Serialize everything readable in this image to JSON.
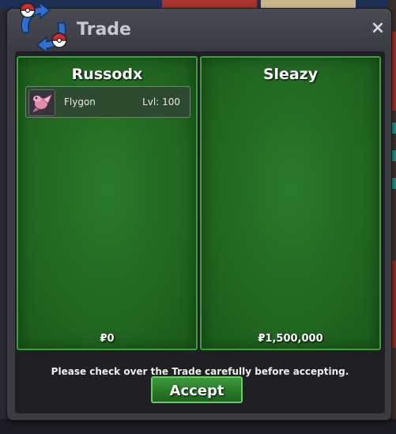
{
  "window": {
    "title": "Trade",
    "close_label": "×"
  },
  "players": [
    {
      "name": "Russodx",
      "money": "₽0",
      "offer": [
        {
          "pokemon": "Flygon",
          "level": "Lvl: 100",
          "icon": "flygon-sprite-icon"
        }
      ]
    },
    {
      "name": "Sleazy",
      "money": "₽1,500,000",
      "offer": []
    }
  ],
  "notice": "Please check over the Trade carefully before accepting.",
  "accept_label": "Accept",
  "colors": {
    "panel_green": "#236b23",
    "panel_border": "#3aa03a",
    "accept_green": "#2a7a2a",
    "window_bg": "#3b3b42"
  }
}
